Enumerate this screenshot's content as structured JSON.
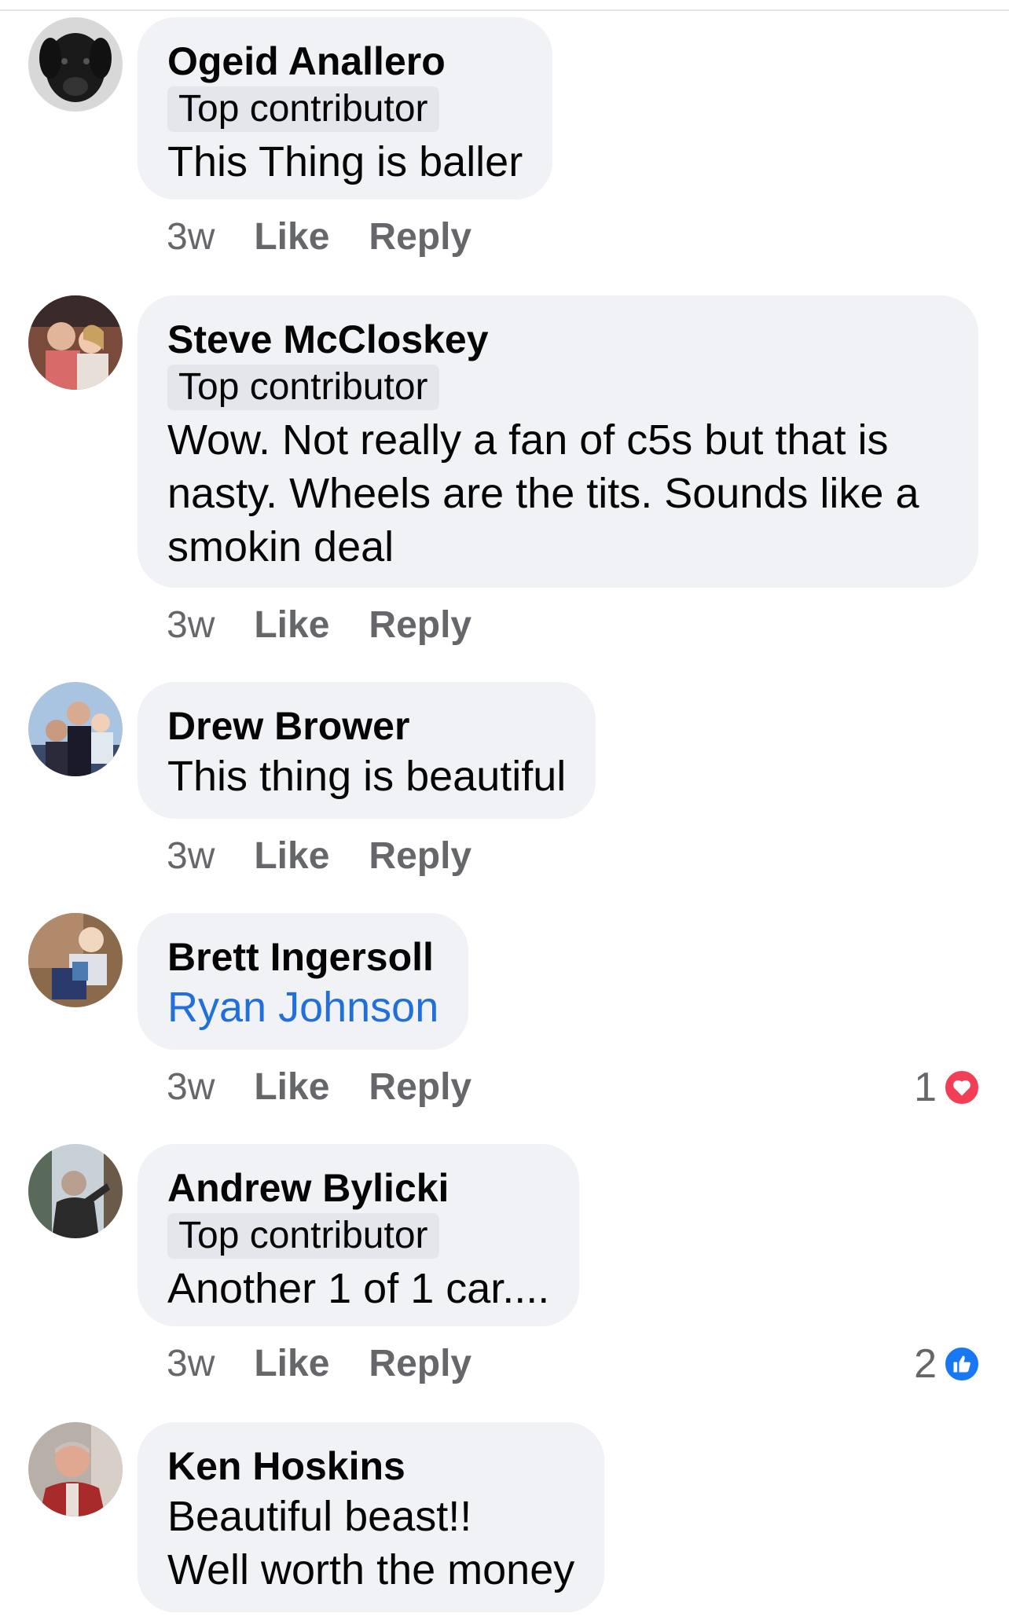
{
  "comments": [
    {
      "author": "Ogeid Anallero",
      "badge": "Top contributor",
      "text": "This Thing is baller",
      "time": "3w",
      "like_label": "Like",
      "reply_label": "Reply",
      "avatar_icon": "dog-photo-avatar"
    },
    {
      "author": "Steve McCloskey",
      "badge": "Top contributor",
      "text": "Wow. Not really a fan of c5s but that is nasty. Wheels are the tits. Sounds like a smokin deal",
      "time": "3w",
      "like_label": "Like",
      "reply_label": "Reply",
      "avatar_icon": "couple-photo-avatar"
    },
    {
      "author": "Drew Brower",
      "text": "This thing is beautiful",
      "time": "3w",
      "like_label": "Like",
      "reply_label": "Reply",
      "avatar_icon": "family-photo-avatar"
    },
    {
      "author": "Brett Ingersoll",
      "text": "Ryan Johnson",
      "text_is_mention": true,
      "time": "3w",
      "like_label": "Like",
      "reply_label": "Reply",
      "reaction_count": "1",
      "reaction_type": "love-icon",
      "avatar_icon": "child-photo-avatar"
    },
    {
      "author": "Andrew Bylicki",
      "badge": "Top contributor",
      "text": "Another 1 of 1 car....",
      "time": "3w",
      "like_label": "Like",
      "reply_label": "Reply",
      "reaction_count": "2",
      "reaction_type": "like-icon",
      "avatar_icon": "outdoor-photo-avatar"
    },
    {
      "author": "Ken Hoskins",
      "text_line1": "Beautiful beast!!",
      "text_line2": "Well worth the money",
      "avatar_icon": "man-photo-avatar"
    }
  ],
  "colors": {
    "bubble_bg": "#f0f2f5",
    "badge_bg": "#e4e6eb",
    "meta_text": "#65676b",
    "mention": "#216fdb",
    "love": "#f33e58",
    "like": "#1877f2"
  }
}
